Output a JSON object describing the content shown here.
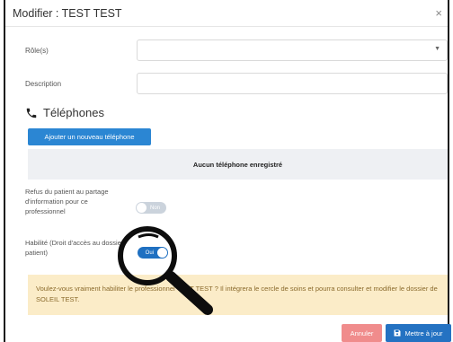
{
  "modal": {
    "title": "Modifier : TEST TEST",
    "close_symbol": "×"
  },
  "form": {
    "roles_label": "Rôle(s)",
    "description_label": "Description",
    "phones_title": "Téléphones",
    "add_phone_label": "Ajouter un nouveau téléphone",
    "no_phone_text": "Aucun téléphone enregistré",
    "refusal_label": "Refus du patient au partage d'information pour ce professionnel",
    "refusal_toggle_text": "Non",
    "refusal_on": false,
    "habilite_label": "Habilité (Droit d'accès au dossier patient)",
    "habilite_toggle_text": "Oui",
    "habilite_on": true
  },
  "warning": {
    "text": "Voulez-vous vraiment habiliter le professionnel TEST TEST ? Il intégrera le cercle de soins et pourra consulter et modifier le dossier de SOLEIL TEST."
  },
  "footer": {
    "cancel_label": "Annuler",
    "update_label": "Mettre à jour"
  },
  "icons": {
    "phone": "phone-icon",
    "save": "save-icon",
    "chevron": "chevron-down-icon",
    "magnifier": "magnifier-icon"
  },
  "colors": {
    "primary": "#2b86d3",
    "cancel": "#f08c8c",
    "warning_bg": "#fbecc8",
    "warning_text": "#8a6a2c",
    "empty_bg": "#eef0f3"
  }
}
